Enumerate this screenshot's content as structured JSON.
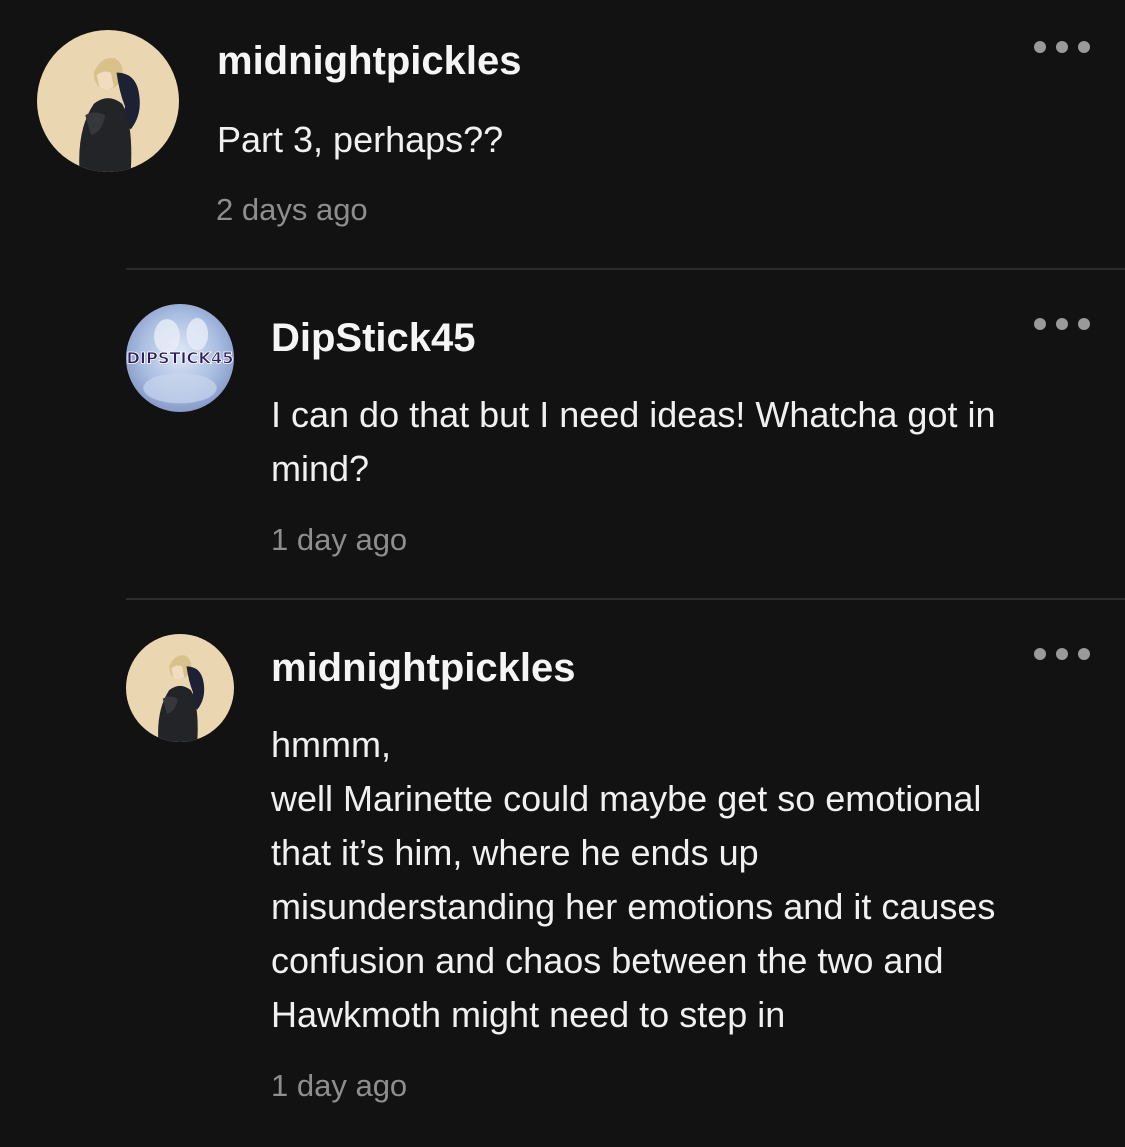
{
  "comments": [
    {
      "username": "midnightpickles",
      "text": "Part 3, perhaps??",
      "time": "2 days ago",
      "avatar_icon": "anime-character-avatar",
      "avatar_bg": "#ead7b2"
    },
    {
      "username": "DipStick45",
      "text": "I can do that but I need ideas! Whatcha got in\nmind?",
      "time": "1 day ago",
      "avatar_icon": "dipstick45-logo-avatar",
      "avatar_label": "DIPSTICK45",
      "avatar_bg": "#9fb3d8"
    },
    {
      "username": "midnightpickles",
      "text": "hmmm,\nwell Marinette could maybe get so emotional\nthat it’s him, where he ends up\nmisunderstanding her emotions and it causes\nconfusion and chaos between the two and\nHawkmoth might need to step in",
      "time": "1 day ago",
      "avatar_icon": "anime-character-avatar",
      "avatar_bg": "#ead7b2"
    }
  ],
  "more_icon": "ellipsis-icon",
  "colors": {
    "background": "#121212",
    "text": "#f0f0f0",
    "muted": "#8e8e8e",
    "divider": "#2c2c2c"
  }
}
